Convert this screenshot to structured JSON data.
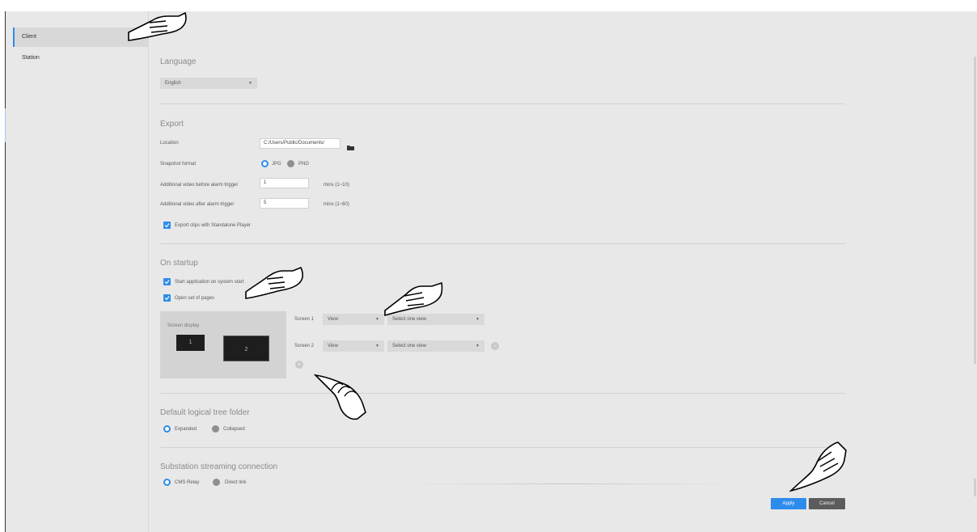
{
  "sidebar": {
    "items": [
      {
        "label": "Client",
        "active": true
      },
      {
        "label": "Station",
        "active": false
      }
    ]
  },
  "language": {
    "title": "Language",
    "selected": "English"
  },
  "export": {
    "title": "Export",
    "location_label": "Location",
    "location_value": "C:/Users/Public/Documents/",
    "snapshot_label": "Snapshot format",
    "snapshot_options": [
      "JPG",
      "PNG"
    ],
    "snapshot_selected": "JPG",
    "before_label": "Additional video before alarm trigger",
    "before_value": "1",
    "before_unit": "mins (1~10)",
    "after_label": "Additional video after alarm trigger",
    "after_value": "5",
    "after_unit": "mins (1~60)",
    "standalone_label": "Export clips with Standalone Player",
    "standalone_checked": true
  },
  "startup": {
    "title": "On startup",
    "start_app_label": "Start application on system start",
    "start_app_checked": true,
    "open_pages_label": "Open set of pages",
    "open_pages_checked": true,
    "screen_display_label": "Screen display",
    "monitors": [
      "1",
      "2"
    ],
    "screens": [
      {
        "label": "Screen 1",
        "type": "View",
        "view": "Select one view"
      },
      {
        "label": "Screen 2",
        "type": "View",
        "view": "Select one view"
      }
    ],
    "add_symbol": "+",
    "remove_symbol": "−"
  },
  "tree_folder": {
    "title": "Default logical tree folder",
    "options": [
      "Expanded",
      "Collapsed"
    ],
    "selected": "Expanded"
  },
  "substation": {
    "title": "Substation streaming connection",
    "options": [
      "CMS Relay",
      "Direct link"
    ],
    "selected": "CMS Relay"
  },
  "actions": {
    "apply_label": "Apply",
    "cancel_label": "Cancel"
  },
  "colors": {
    "accent": "#2d8ceb",
    "background": "#e8e8e8",
    "cancel": "#5c5c5c"
  },
  "icons": [
    "folder-icon",
    "caret-down-icon",
    "check-icon",
    "pointing-hand-icon",
    "add-icon",
    "remove-icon"
  ]
}
